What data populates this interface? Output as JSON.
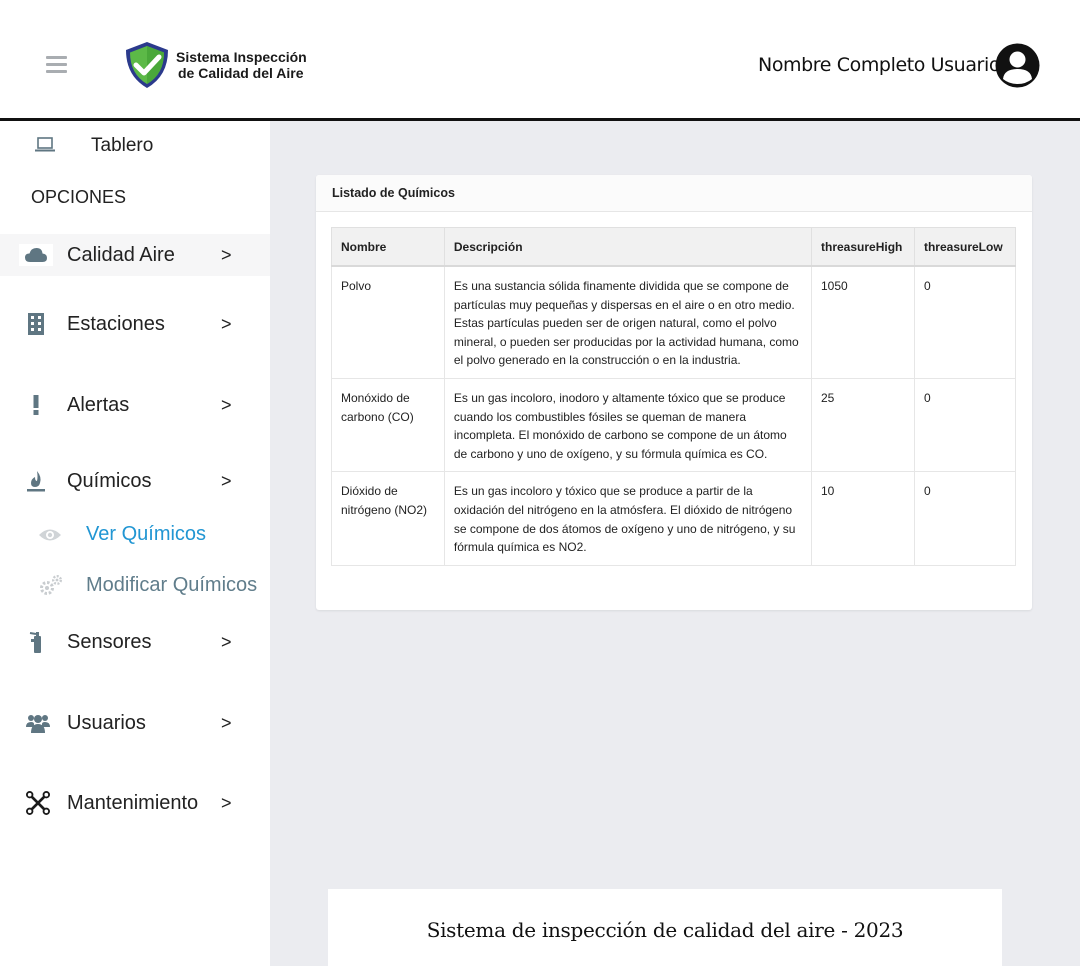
{
  "header": {
    "app_title_line1": "Sistema Inspección",
    "app_title_line2": "de Calidad del Aire",
    "user_name": "Nombre Completo Usuario"
  },
  "sidebar": {
    "dashboard_label": "Tablero",
    "section_title": "OPCIONES",
    "items": [
      {
        "label": "Calidad Aire",
        "arrow": ">",
        "icon": "cloud-icon"
      },
      {
        "label": "Estaciones",
        "arrow": ">",
        "icon": "building-icon"
      },
      {
        "label": "Alertas",
        "arrow": ">",
        "icon": "exclamation-icon"
      },
      {
        "label": "Químicos",
        "arrow": ">",
        "icon": "flask-icon"
      },
      {
        "label": "Sensores",
        "arrow": ">",
        "icon": "sensor-icon"
      },
      {
        "label": "Usuarios",
        "arrow": ">",
        "icon": "users-icon"
      },
      {
        "label": "Mantenimiento",
        "arrow": ">",
        "icon": "tools-icon"
      }
    ],
    "sub_items": [
      {
        "label": "Ver Químicos",
        "icon": "eye-icon",
        "color": "#2196d3"
      },
      {
        "label": "Modificar Químicos",
        "icon": "gears-icon",
        "color": "#607d8b"
      }
    ]
  },
  "card": {
    "title": "Listado de Químicos",
    "columns": [
      "Nombre",
      "Descripción",
      "threasureHigh",
      "threasureLow"
    ],
    "rows": [
      [
        "Polvo",
        "Es una sustancia sólida finamente dividida que se compone de partículas muy pequeñas y dispersas en el aire o en otro medio. Estas partículas pueden ser de origen natural, como el polvo mineral, o pueden ser producidas por la actividad humana, como el polvo generado en la construcción o en la industria.",
        "1050",
        "0"
      ],
      [
        "Monóxido de carbono (CO)",
        "Es un gas incoloro, inodoro y altamente tóxico que se produce cuando los combustibles fósiles se queman de manera incompleta. El monóxido de carbono se compone de un átomo de carbono y uno de oxígeno, y su fórmula química es CO.",
        "25",
        "0"
      ],
      [
        "Dióxido de nitrógeno (NO2)",
        "Es un gas incoloro y tóxico que se produce a partir de la oxidación del nitrógeno en la atmósfera. El dióxido de nitrógeno se compone de dos átomos de oxígeno y uno de nitrógeno, y su fórmula química es NO2.",
        "10",
        "0"
      ]
    ]
  },
  "footer": {
    "text": "Sistema de inspección de calidad del aire - 2023"
  },
  "colors": {
    "icon_gray": "#5f7682",
    "accent_blue": "#2196d3",
    "shield_blue": "#2b3a8c",
    "shield_green": "#5cb947"
  }
}
